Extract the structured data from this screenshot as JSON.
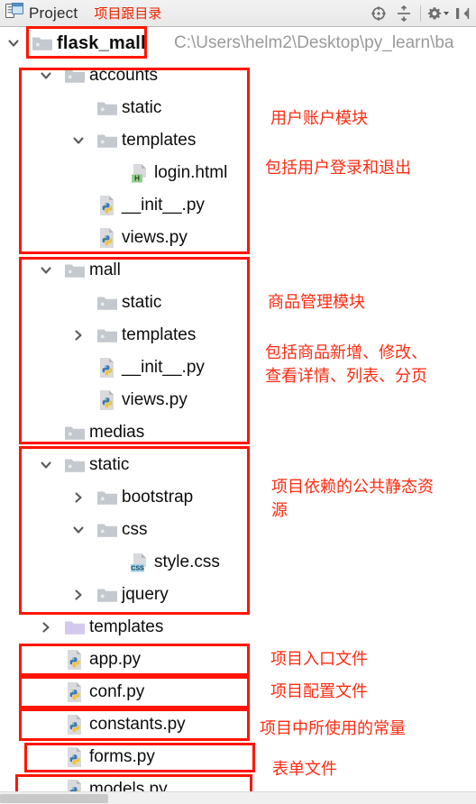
{
  "window": {
    "title": "Project",
    "title_icon": "project-tool-window-icon",
    "header_annotation": "项目跟目录",
    "toolbar": [
      {
        "name": "scroll-from-source-icon",
        "label": ""
      },
      {
        "name": "collapse-all-icon",
        "label": ""
      },
      {
        "name": "settings-gear-icon",
        "label": ""
      },
      {
        "name": "hide-panel-icon",
        "label": ""
      }
    ]
  },
  "tree": {
    "root": {
      "label": "flask_mall",
      "path": "C:\\Users\\helm2\\Desktop\\py_learn\\ba",
      "icon": "folder-icon",
      "arrow": "expanded"
    },
    "rows": [
      {
        "label": "accounts",
        "icon": "folder-icon",
        "arrow": "expanded",
        "indent": 1
      },
      {
        "label": "static",
        "icon": "folder-icon",
        "arrow": "none",
        "indent": 2
      },
      {
        "label": "templates",
        "icon": "folder-icon",
        "arrow": "expanded",
        "indent": 2
      },
      {
        "label": "login.html",
        "icon": "html-file-icon",
        "arrow": "none",
        "indent": 3
      },
      {
        "label": "__init__.py",
        "icon": "python-file-icon",
        "arrow": "none",
        "indent": 2
      },
      {
        "label": "views.py",
        "icon": "python-file-icon",
        "arrow": "none",
        "indent": 2
      },
      {
        "label": "mall",
        "icon": "folder-icon",
        "arrow": "expanded",
        "indent": 1
      },
      {
        "label": "static",
        "icon": "folder-icon",
        "arrow": "none",
        "indent": 2
      },
      {
        "label": "templates",
        "icon": "folder-icon",
        "arrow": "collapsed",
        "indent": 2
      },
      {
        "label": "__init__.py",
        "icon": "python-file-icon",
        "arrow": "none",
        "indent": 2
      },
      {
        "label": "views.py",
        "icon": "python-file-icon",
        "arrow": "none",
        "indent": 2
      },
      {
        "label": "medias",
        "icon": "folder-icon",
        "arrow": "none",
        "indent": 1
      },
      {
        "label": "static",
        "icon": "folder-icon",
        "arrow": "expanded",
        "indent": 1
      },
      {
        "label": "bootstrap",
        "icon": "folder-icon",
        "arrow": "collapsed",
        "indent": 2
      },
      {
        "label": "css",
        "icon": "folder-icon",
        "arrow": "expanded",
        "indent": 2
      },
      {
        "label": "style.css",
        "icon": "css-file-icon",
        "arrow": "none",
        "indent": 3
      },
      {
        "label": "jquery",
        "icon": "folder-icon",
        "arrow": "collapsed",
        "indent": 2
      },
      {
        "label": "templates",
        "icon": "folder-purple-icon",
        "arrow": "collapsed",
        "indent": 1
      },
      {
        "label": "app.py",
        "icon": "python-file-icon",
        "arrow": "none",
        "indent": 1
      },
      {
        "label": "conf.py",
        "icon": "python-file-icon",
        "arrow": "none",
        "indent": 1
      },
      {
        "label": "constants.py",
        "icon": "python-file-icon",
        "arrow": "none",
        "indent": 1
      },
      {
        "label": "forms.py",
        "icon": "python-file-icon",
        "arrow": "none",
        "indent": 1
      },
      {
        "label": "models.py",
        "icon": "python-file-icon",
        "arrow": "none",
        "indent": 1
      }
    ]
  },
  "annotations": {
    "color": "#ff2b11",
    "box_color": "#ff1500",
    "notes": [
      {
        "name": "note-root-dir",
        "text": "项目跟目录"
      },
      {
        "name": "note-accounts-module",
        "text": "用户账户模块"
      },
      {
        "name": "note-accounts-detail",
        "text": "包括用户登录和退出"
      },
      {
        "name": "note-mall-module",
        "text": "商品管理模块"
      },
      {
        "name": "note-mall-detail",
        "text": "包括商品新增、修改、\n查看详情、列表、分页"
      },
      {
        "name": "note-static-module",
        "text": "项目依赖的公共静态资\n源"
      },
      {
        "name": "note-app-entry",
        "text": "项目入口文件"
      },
      {
        "name": "note-conf-file",
        "text": "项目配置文件"
      },
      {
        "name": "note-constants-file",
        "text": "项目中所使用的常量"
      },
      {
        "name": "note-forms-file",
        "text": "表单文件"
      }
    ]
  }
}
